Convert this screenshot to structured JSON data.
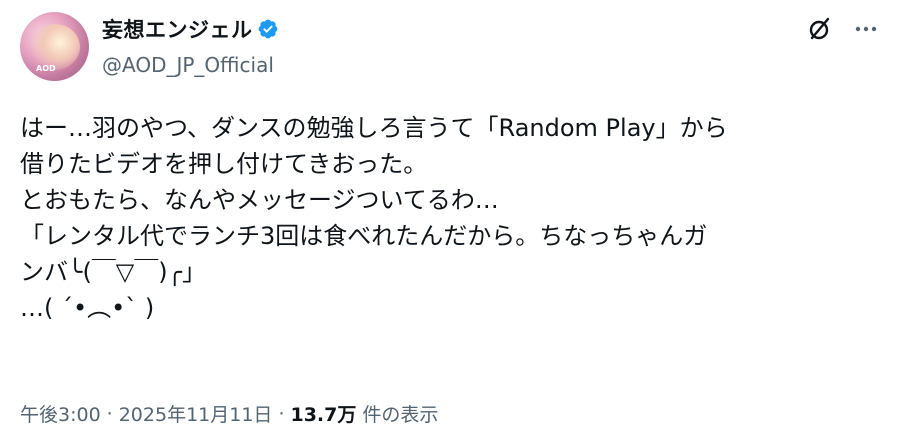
{
  "user": {
    "display_name": "妄想エンジェル",
    "handle": "@AOD_JP_Official",
    "avatar_logo": "AOD",
    "verified": true
  },
  "tweet": {
    "lines": [
      "はー…羽のやつ、ダンスの勉強しろ言うて「Random Play」から",
      "借りたビデオを押し付けてきおった。",
      "とおもたら、なんやメッセージついてるわ…",
      "「レンタル代でランチ3回は食べれたんだから。ちなっちゃんガ",
      "ンバ╰(￣▽￣)╭」",
      "…( ´•︵•` )"
    ]
  },
  "meta": {
    "time": "午後3:00",
    "separator": "·",
    "date": "2025年11月11日",
    "views_count": "13.7万",
    "views_label": "件の表示"
  },
  "icons": {
    "verified": "verified-badge-icon",
    "grok": "grok-icon",
    "more": "more-options-icon"
  },
  "colors": {
    "verified_blue": "#1d9bf0",
    "text_primary": "#0f1419",
    "text_secondary": "#536471"
  }
}
